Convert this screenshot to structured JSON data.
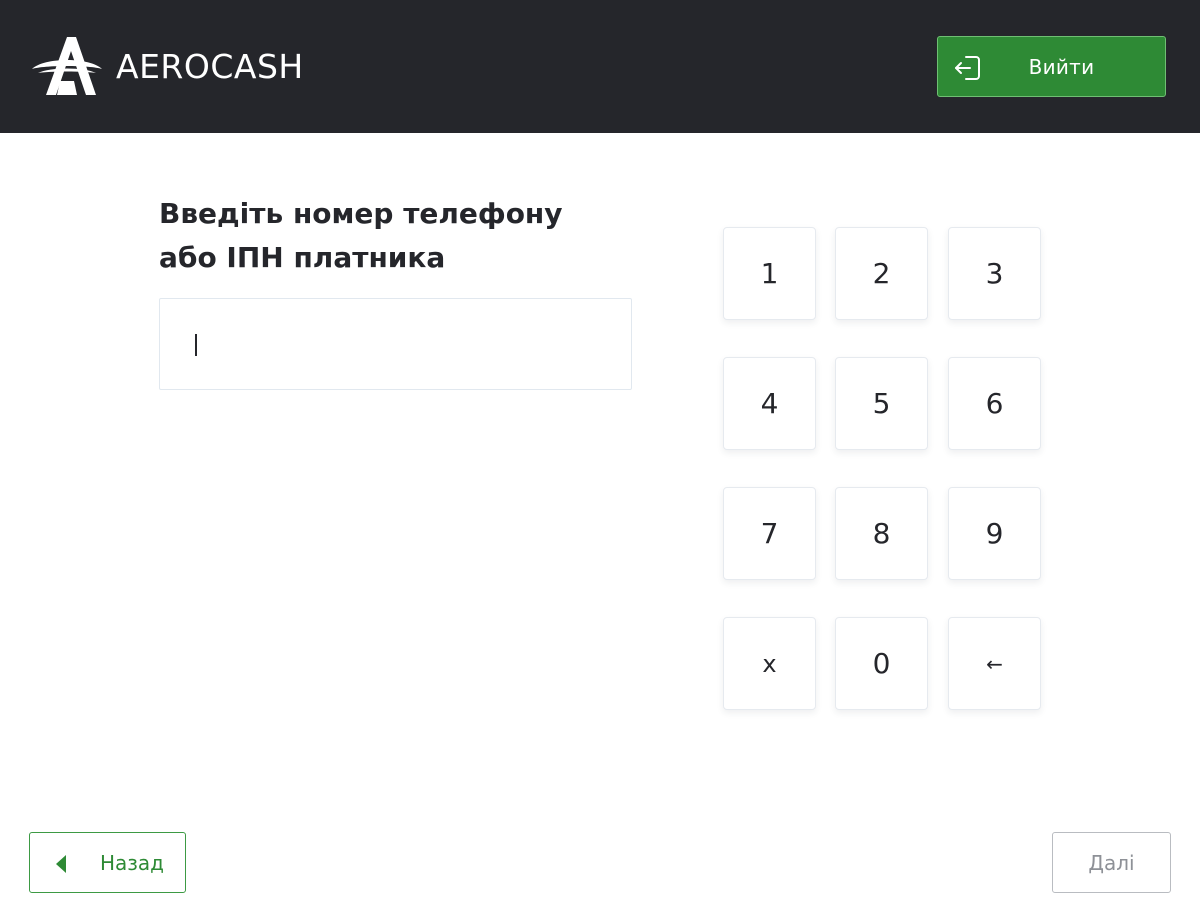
{
  "header": {
    "brand": "AEROCASH",
    "logo_icon": "aerocash-logo-icon",
    "exit_button": {
      "label": "Вийти",
      "icon": "logout-icon"
    }
  },
  "form": {
    "prompt_line1": "Введіть номер телефону",
    "prompt_line2": "або ІПН платника",
    "input_value": ""
  },
  "keypad": {
    "keys": [
      "1",
      "2",
      "3",
      "4",
      "5",
      "6",
      "7",
      "8",
      "9",
      "x",
      "0",
      "←"
    ]
  },
  "footer": {
    "back_label": "Назад",
    "back_icon": "triangle-left-icon",
    "next_label": "Далі"
  },
  "colors": {
    "header_bg": "#25262b",
    "accent_green": "#2e8a35",
    "text_dark": "#25262b",
    "disabled_gray": "#8e9197"
  }
}
